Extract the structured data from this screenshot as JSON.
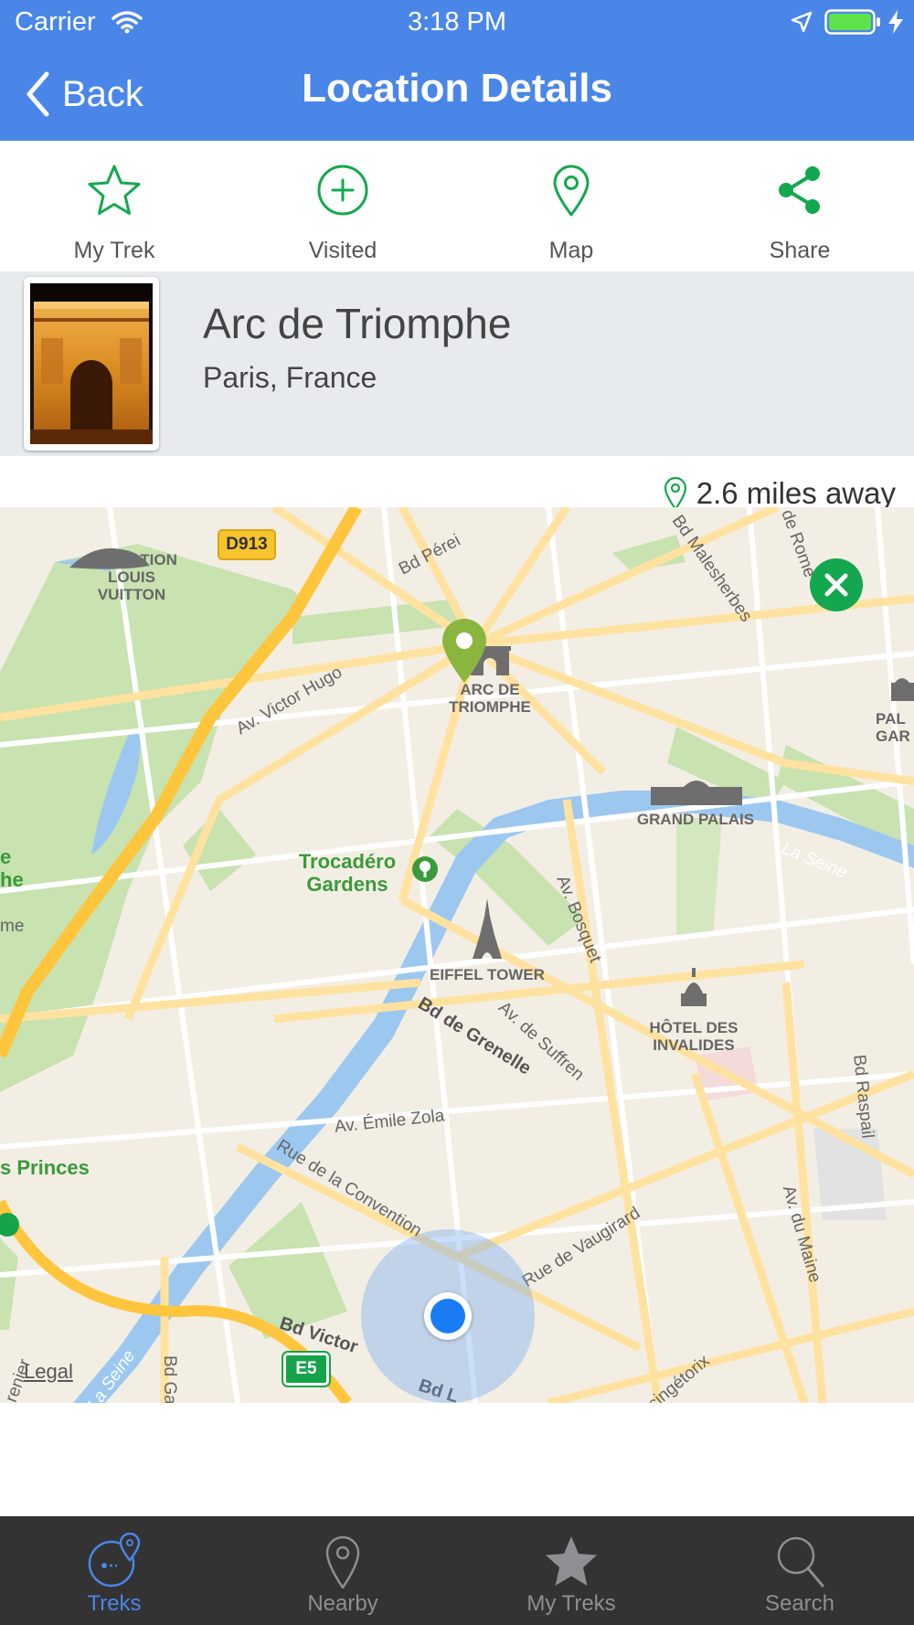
{
  "status_bar": {
    "carrier": "Carrier",
    "time": "3:18 PM"
  },
  "nav": {
    "back_label": "Back",
    "title": "Location Details"
  },
  "actions": [
    {
      "label": "My Trek",
      "icon": "star-icon"
    },
    {
      "label": "Visited",
      "icon": "plus-circle-icon"
    },
    {
      "label": "Map",
      "icon": "map-pin-icon"
    },
    {
      "label": "Share",
      "icon": "share-icon"
    }
  ],
  "location": {
    "name": "Arc de Triomphe",
    "place": "Paris, France",
    "distance": "2.6 miles away"
  },
  "map": {
    "labels": {
      "fondation": [
        "FONDATION",
        "LOUIS",
        "VUITTON"
      ],
      "arc": [
        "ARC DE",
        "TRIOMPHE"
      ],
      "grand_palais": "GRAND PALAIS",
      "trocadero": [
        "Trocadéro",
        "Gardens"
      ],
      "eiffel": "EIFFEL TOWER",
      "invalides": [
        "HÔTEL DES",
        "INVALIDES"
      ],
      "la_seine": "La Seine",
      "la_seine_2": "La Seine",
      "victor_hugo": "Av. Victor Hugo",
      "bosquet": "Av. Bosquet",
      "suffren": "Av. de Suffren",
      "grenelle": "Bd de Grenelle",
      "emile_zola": "Av. Émile Zola",
      "convention": "Rue de la Convention",
      "vaugirard": "Rue de Vaugirard",
      "raspail": "Bd Raspail",
      "maine": "Av. du Maine",
      "malesherbes": "Bd Malesherbes",
      "rome": "de Rome",
      "pereire": "Bd Pérei",
      "bd_victor": "Bd Victor",
      "princes": "s Princes",
      "d913": "D913",
      "e5": "E5",
      "pal": [
        "PAL",
        "GAR"
      ],
      "vercingetorix": "rcingétorix",
      "left_e": [
        "e",
        "he"
      ],
      "left_me": "me",
      "bd_bottom": "Bd L",
      "grenier": "renier",
      "bd_ga": "Bd Ga"
    },
    "legal": "Legal"
  },
  "tabs": [
    {
      "label": "Treks",
      "icon": "treks-icon",
      "active": true
    },
    {
      "label": "Nearby",
      "icon": "map-pin-icon",
      "active": false
    },
    {
      "label": "My Treks",
      "icon": "star-icon",
      "active": false
    },
    {
      "label": "Search",
      "icon": "search-icon",
      "active": false
    }
  ],
  "colors": {
    "nav_blue": "#4a86e8",
    "accent_green": "#13a84f",
    "pin_green": "#8ab63f",
    "tab_bar": "#333333",
    "user_dot": "#1a7cf5"
  }
}
